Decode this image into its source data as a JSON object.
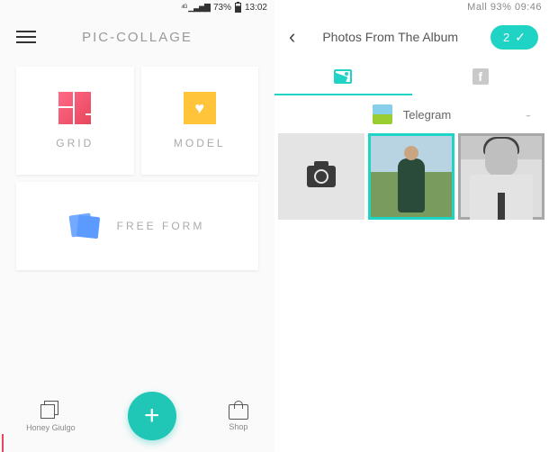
{
  "left_status": {
    "battery_pct": "73%",
    "time": "13:02"
  },
  "right_status": {
    "text": "Mall 93% 09:46"
  },
  "left_header": {
    "title": "PIC-COLLAGE"
  },
  "tiles": {
    "grid": "GRID",
    "model": "MODEL",
    "freeform": "FREE FORM"
  },
  "bottom_nav": {
    "honey": "Honey Giulgo",
    "shop": "Shop"
  },
  "fab": {
    "label": "+"
  },
  "right_header": {
    "title": "Photos From The Album",
    "count": "2"
  },
  "album": {
    "name": "Telegram"
  },
  "colors": {
    "accent": "#1fd4c4",
    "pink": "#e8465c",
    "yellow": "#ffc43a",
    "blue": "#5b9bff"
  }
}
